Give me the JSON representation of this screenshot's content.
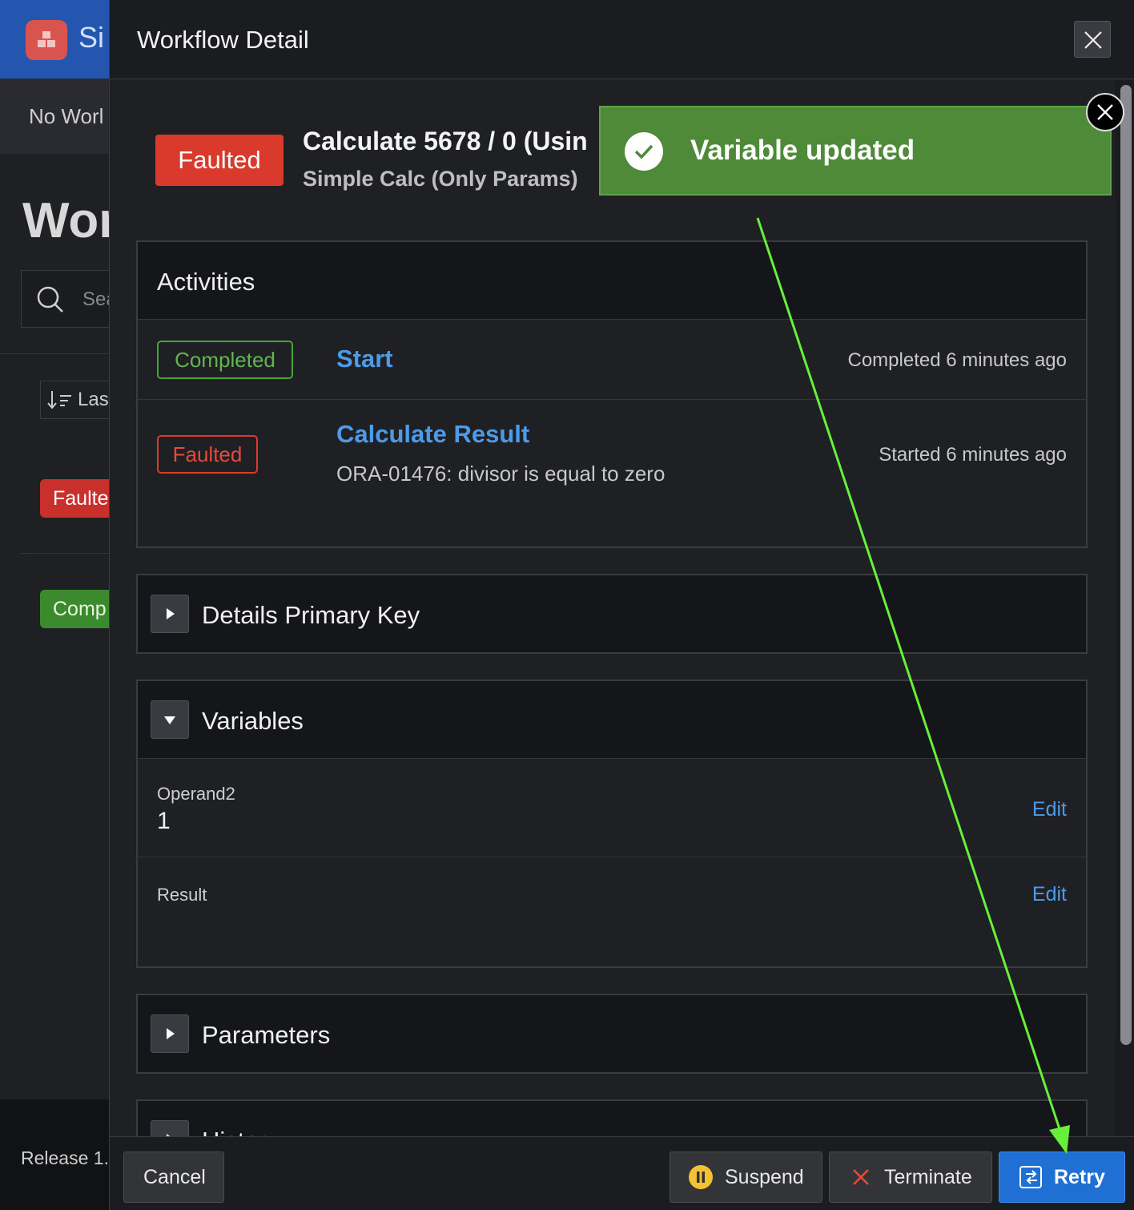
{
  "background": {
    "app_title": "Si",
    "sub_header": "No Worl",
    "heading": "Wor",
    "search_placeholder": "Sea",
    "sort_label": "Las",
    "badge_faulted": "Faulte",
    "badge_completed": "Comp",
    "footer_release": "Release 1."
  },
  "dialog": {
    "title": "Workflow Detail",
    "workflow": {
      "status": "Faulted",
      "title": "Calculate 5678 / 0 (Usin",
      "subtitle": "Simple Calc (Only Params)"
    },
    "activities": {
      "title": "Activities",
      "rows": [
        {
          "status": "Completed",
          "name": "Start",
          "message": "",
          "time": "Completed 6 minutes ago"
        },
        {
          "status": "Faulted",
          "name": "Calculate Result",
          "message": "ORA-01476: divisor is equal to zero",
          "time": "Started 6 minutes ago"
        }
      ]
    },
    "sections": {
      "details_primary_key": "Details Primary Key",
      "variables": "Variables",
      "parameters": "Parameters",
      "history": "History"
    },
    "variables": [
      {
        "name": "Operand2",
        "value": "1",
        "edit": "Edit"
      },
      {
        "name": "Result",
        "value": "",
        "edit": "Edit"
      }
    ],
    "footer": {
      "cancel": "Cancel",
      "suspend": "Suspend",
      "terminate": "Terminate",
      "retry": "Retry"
    }
  },
  "toast": {
    "message": "Variable updated"
  },
  "colors": {
    "faulted": "#d93a2c",
    "completed": "#4aa23a",
    "link": "#4d9be8",
    "toast": "#4e8a38",
    "retry": "#1f6fd4",
    "annotation_arrow": "#66f03a"
  }
}
